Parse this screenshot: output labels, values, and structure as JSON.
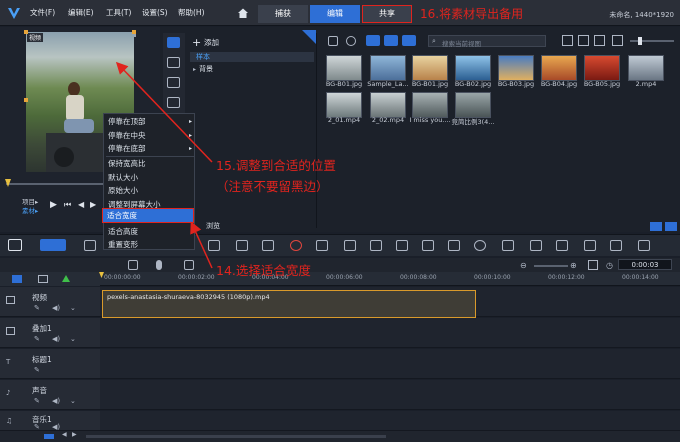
{
  "title_bar": {
    "menu": [
      "文件(F)",
      "编辑(E)",
      "工具(T)",
      "设置(S)",
      "帮助(H)"
    ],
    "tabs": {
      "capture": "捕获",
      "edit": "编辑",
      "share": "共享"
    },
    "project_info": "未命名, 1440*1920"
  },
  "annotations": {
    "step16": "16.将素材导出备用",
    "step15_line1": "15.调整到合适的位置",
    "step15_line2": "（注意不要留黑边）",
    "step14": "14.选择适合宽度"
  },
  "preview": {
    "badge": "视频",
    "project_label": "项目▸",
    "clip_label": "素材▸"
  },
  "library": {
    "add_label": "添加",
    "folders": [
      "样本",
      "背景"
    ],
    "search_placeholder": "搜索当前视图",
    "browse_label": "浏览",
    "media": [
      "BG-B01.jpg",
      "Sample_La...",
      "BG-B01.jpg",
      "BG-B02.jpg",
      "BG-B03.jpg",
      "BG-B04.jpg",
      "BG-B05.jpg",
      "2.mp4",
      "2_01.mp4",
      "2_02.mp4",
      "I miss you....",
      "竞简比例3(4..."
    ]
  },
  "context_menu": {
    "items": [
      "停靠在顶部",
      "停靠在中央",
      "停靠在底部",
      "保持宽高比",
      "默认大小",
      "原始大小",
      "调整到屏幕大小",
      "适合宽度",
      "适合高度",
      "重置变形"
    ],
    "selected_index": 7
  },
  "timeline": {
    "ruler": [
      "00:00:00:00",
      "00:00:02:00",
      "00:00:04:00",
      "00:00:06:00",
      "00:00:08:00",
      "00:00:10:00",
      "00:00:12:00",
      "00:00:14:00"
    ],
    "timecode": "0:00:03",
    "tracks": [
      "视频",
      "叠加1",
      "标题1",
      "声音",
      "音乐1"
    ],
    "clip_name": "pexels-anastasia-shuraeva-8032945 (1080p).mp4"
  },
  "colors": {
    "accent_blue": "#2e6fd6",
    "annotation_red": "#e0241e",
    "clip_border": "#d99a2b"
  }
}
